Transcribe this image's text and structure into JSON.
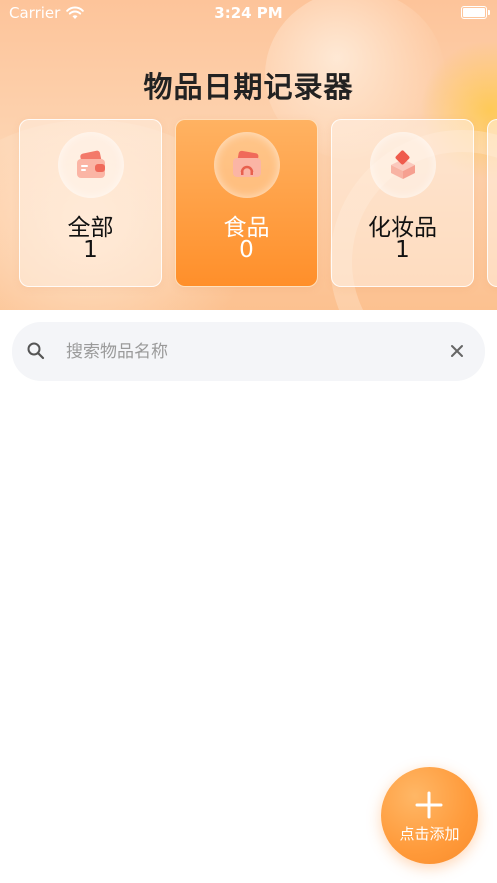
{
  "status_bar": {
    "carrier": "Carrier",
    "time": "3:24 PM"
  },
  "app": {
    "title": "物品日期记录器"
  },
  "categories": [
    {
      "name": "全部",
      "count": "1",
      "icon": "wallet-icon",
      "active": false
    },
    {
      "name": "食品",
      "count": "0",
      "icon": "food-box-icon",
      "active": true
    },
    {
      "name": "化妆品",
      "count": "1",
      "icon": "cosmetics-icon",
      "active": false
    }
  ],
  "search": {
    "placeholder": "搜索物品名称",
    "value": ""
  },
  "fab": {
    "label": "点击添加"
  },
  "colors": {
    "accent": "#ff9a3a",
    "header": "#fdc49a"
  }
}
